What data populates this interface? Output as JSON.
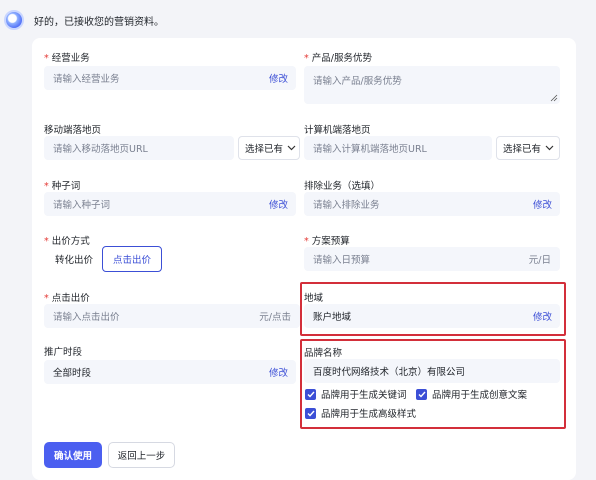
{
  "chat": {
    "bot_message": "好的，已接收您的营销资料。"
  },
  "form": {
    "required_mark": "*",
    "business": {
      "label": "经营业务",
      "placeholder": "请输入经营业务",
      "action": "修改"
    },
    "advantage": {
      "label": "产品/服务优势",
      "placeholder": "请输入产品/服务优势"
    },
    "mobile_landing": {
      "label": "移动端落地页",
      "placeholder": "请输入移动落地页URL",
      "select": "选择已有"
    },
    "pc_landing": {
      "label": "计算机端落地页",
      "placeholder": "请输入计算机端落地页URL",
      "select": "选择已有"
    },
    "seed_words": {
      "label": "种子词",
      "placeholder": "请输入种子词",
      "action": "修改"
    },
    "exclude_business": {
      "label": "排除业务（选填）",
      "placeholder": "请输入排除业务",
      "action": "修改"
    },
    "bid_mode": {
      "label": "出价方式",
      "options": [
        "转化出价",
        "点击出价"
      ],
      "selected": "点击出价"
    },
    "budget": {
      "label": "方案预算",
      "placeholder": "请输入日预算",
      "unit": "元/日"
    },
    "click_bid": {
      "label": "点击出价",
      "placeholder": "请输入点击出价",
      "unit": "元/点击"
    },
    "region": {
      "label": "地域",
      "value": "账户地域",
      "action": "修改"
    },
    "schedule": {
      "label": "推广时段",
      "value": "全部时段",
      "action": "修改"
    },
    "brand": {
      "label": "品牌名称",
      "value": "百度时代网络技术（北京）有限公司",
      "checks": [
        "品牌用于生成关键词",
        "品牌用于生成创意文案",
        "品牌用于生成高级样式"
      ]
    },
    "confirm_button": "确认使用",
    "back_button": "返回上一步"
  },
  "colors": {
    "accent": "#4b5ff0",
    "highlight_box": "#d32f3a"
  }
}
